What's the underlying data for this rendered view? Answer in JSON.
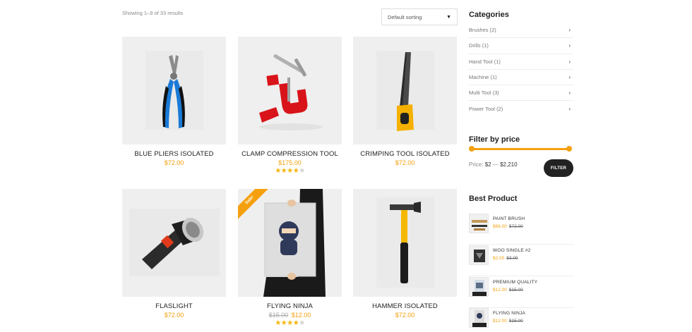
{
  "toolbar": {
    "result_count": "Showing 1–9 of 33 results",
    "sort_value": "Default sorting"
  },
  "products": [
    {
      "title": "BLUE PLIERS ISOLATED",
      "price": "$72.00",
      "icon": "pliers-image"
    },
    {
      "title": "CLAMP COMPRESSION TOOL",
      "price": "$175.00",
      "rating": 4,
      "icon": "clamp-image"
    },
    {
      "title": "CRIMPING TOOL ISOLATED",
      "price": "$72.00",
      "icon": "saw-image"
    },
    {
      "title": "FLASLIGHT",
      "price": "$72.00",
      "icon": "flashlight-image"
    },
    {
      "title": "FLYING NINJA",
      "old_price": "$15.00",
      "price": "$12.00",
      "rating": 4,
      "sale_badge": "Sale!",
      "icon": "ninja-poster-image"
    },
    {
      "title": "HAMMER ISOLATED",
      "price": "$72.00",
      "icon": "hammer-image"
    }
  ],
  "sidebar": {
    "categories_heading": "Categories",
    "categories": [
      {
        "label": "Brushes",
        "count": "(2)"
      },
      {
        "label": "Drills",
        "count": "(1)"
      },
      {
        "label": "Hand Tool",
        "count": "(1)"
      },
      {
        "label": "Machine",
        "count": "(1)"
      },
      {
        "label": "Multi Tool",
        "count": "(3)"
      },
      {
        "label": "Power Tool",
        "count": "(2)"
      }
    ],
    "filter_heading": "Filter by price",
    "price_prefix": "Price:",
    "price_min": "$2",
    "price_sep": "—",
    "price_max": "$2,210",
    "filter_button": "FILTER",
    "best_heading": "Best Product",
    "best_products": [
      {
        "name": "PAINT BRUSH",
        "price": "$66.00",
        "old_price": "$72.00"
      },
      {
        "name": "WOO SINGLE #2",
        "price": "$2.00",
        "old_price": "$3.00"
      },
      {
        "name": "PREMIUM QUALITY",
        "price": "$12.00",
        "old_price": "$15.00"
      },
      {
        "name": "FLYING NINJA",
        "price": "$12.00",
        "old_price": "$15.00"
      }
    ]
  },
  "colors": {
    "accent": "#f5a00e",
    "dark": "#222222"
  }
}
